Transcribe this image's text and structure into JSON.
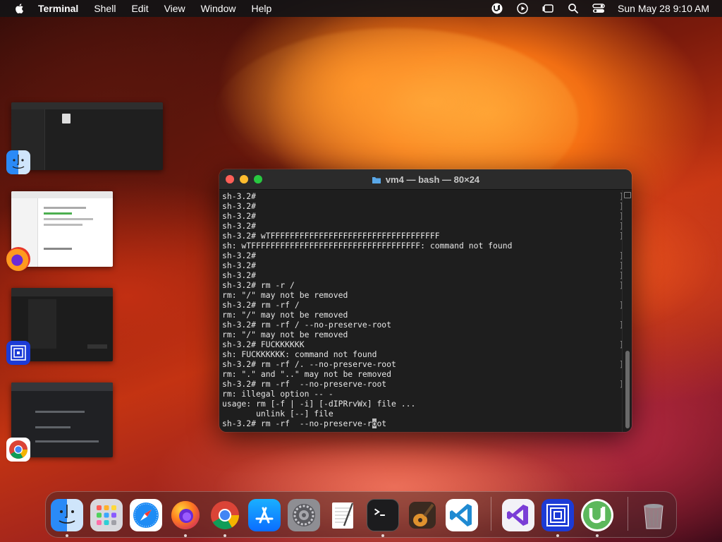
{
  "menubar": {
    "app_name": "Terminal",
    "items": [
      "Shell",
      "Edit",
      "View",
      "Window",
      "Help"
    ],
    "clock": "Sun May 28  9:10 AM"
  },
  "terminal": {
    "title": "vm4 — bash — 80×24",
    "lines": [
      {
        "text": "sh-3.2#",
        "bracket": true
      },
      {
        "text": "sh-3.2#",
        "bracket": true
      },
      {
        "text": "sh-3.2#",
        "bracket": true
      },
      {
        "text": "sh-3.2#",
        "bracket": true
      },
      {
        "text": "sh-3.2# wTFFFFFFFFFFFFFFFFFFFFFFFFFFFFFFFFFFF",
        "bracket": true
      },
      {
        "text": "sh: wTFFFFFFFFFFFFFFFFFFFFFFFFFFFFFFFFFFF: command not found",
        "bracket": false
      },
      {
        "text": "sh-3.2#",
        "bracket": true
      },
      {
        "text": "sh-3.2#",
        "bracket": true
      },
      {
        "text": "sh-3.2#",
        "bracket": true
      },
      {
        "text": "sh-3.2# rm -r /",
        "bracket": true
      },
      {
        "text": "rm: \"/\" may not be removed",
        "bracket": false
      },
      {
        "text": "sh-3.2# rm -rf /",
        "bracket": true
      },
      {
        "text": "rm: \"/\" may not be removed",
        "bracket": false
      },
      {
        "text": "sh-3.2# rm -rf / --no-preserve-root",
        "bracket": true
      },
      {
        "text": "rm: \"/\" may not be removed",
        "bracket": false
      },
      {
        "text": "sh-3.2# FUCKKKKKK",
        "bracket": true
      },
      {
        "text": "sh: FUCKKKKKK: command not found",
        "bracket": false
      },
      {
        "text": "sh-3.2# rm -rf /. --no-preserve-root",
        "bracket": true
      },
      {
        "text": "rm: \".\" and \"..\" may not be removed",
        "bracket": false
      },
      {
        "text": "sh-3.2# rm -rf  --no-preserve-root",
        "bracket": true
      },
      {
        "text": "rm: illegal option -- -",
        "bracket": false
      },
      {
        "text": "usage: rm [-f | -i] [-dIPRrvWx] file ...",
        "bracket": false
      },
      {
        "text": "       unlink [--] file",
        "bracket": false
      }
    ],
    "prompt_before_cursor": "sh-3.2# rm -rf  --no-preserve-r",
    "cursor_char": "o",
    "prompt_after_cursor": "ot"
  },
  "stage_manager": [
    {
      "app": "Finder",
      "icon": "finder-icon"
    },
    {
      "app": "Firefox",
      "icon": "firefox-icon"
    },
    {
      "app": "UTM",
      "icon": "utm-icon"
    },
    {
      "app": "Chrome",
      "icon": "chrome-icon"
    }
  ],
  "dock": {
    "apps": [
      {
        "name": "Finder",
        "icon": "finder-icon",
        "running": true
      },
      {
        "name": "Launchpad",
        "icon": "launchpad-icon",
        "running": false
      },
      {
        "name": "Safari",
        "icon": "safari-icon",
        "running": false
      },
      {
        "name": "Firefox",
        "icon": "firefox-icon",
        "running": true
      },
      {
        "name": "Google Chrome",
        "icon": "chrome-icon",
        "running": true
      },
      {
        "name": "App Store",
        "icon": "app-store-icon",
        "running": false
      },
      {
        "name": "System Settings",
        "icon": "settings-icon",
        "running": false
      },
      {
        "name": "TextEdit",
        "icon": "textedit-icon",
        "running": false
      },
      {
        "name": "Terminal",
        "icon": "terminal-icon",
        "running": true
      },
      {
        "name": "GarageBand",
        "icon": "garageband-icon",
        "running": false
      },
      {
        "name": "Visual Studio Code",
        "icon": "vscode-icon",
        "running": false
      },
      {
        "name": "Visual Studio",
        "icon": "visual-studio-icon",
        "running": false
      },
      {
        "name": "UTM",
        "icon": "utm-icon",
        "running": true
      },
      {
        "name": "uTorrent",
        "icon": "utorrent-icon",
        "running": true
      },
      {
        "name": "Trash",
        "icon": "trash-icon",
        "running": false
      }
    ]
  }
}
